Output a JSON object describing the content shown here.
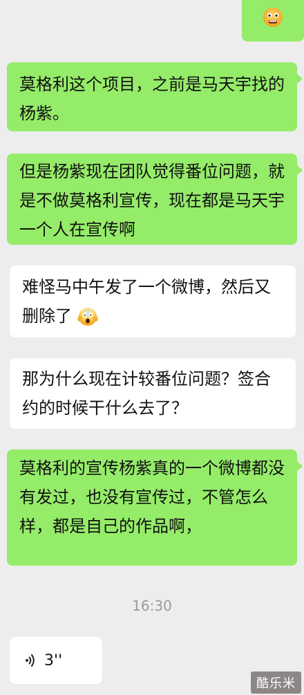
{
  "chat": {
    "messages": [
      {
        "from": "me",
        "emoji": "frowning-face"
      },
      {
        "from": "me",
        "text": "莫格利这个项目，之前是马天宇找的杨紫。"
      },
      {
        "from": "me",
        "text": "但是杨紫现在团队觉得番位问题，就是不做莫格利宣传，现在都是马天宇一个人在宣传啊"
      },
      {
        "from": "other",
        "text": "难怪马中午发了一个微博，然后又删除了",
        "emoji": "screaming-face"
      },
      {
        "from": "other",
        "text": "那为什么现在计较番位问题？签合约的时候干什么去了？"
      },
      {
        "from": "me",
        "text": "莫格利的宣传杨紫真的一个微博都没有发过，也没有宣传过，不管怎么样，都是自己的作品啊，"
      }
    ],
    "timestamp": "16:30",
    "voice": {
      "duration": "3''",
      "icon": "voice-wave-icon"
    }
  },
  "watermark": {
    "text": "酷乐米"
  },
  "colors": {
    "background": "#ededed",
    "me_bubble": "#95ec69",
    "other_bubble": "#ffffff",
    "timestamp": "#9a9a9a"
  }
}
